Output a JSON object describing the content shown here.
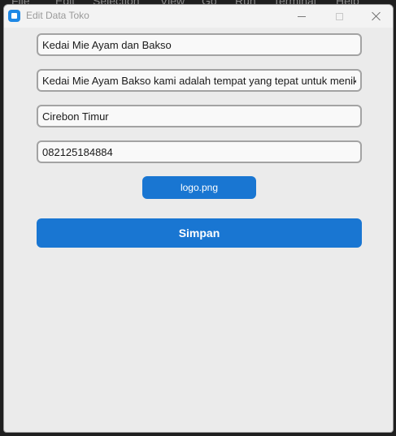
{
  "background_menu": {
    "items": [
      "File",
      "Edit",
      "Selection",
      "View",
      "Go",
      "Run",
      "Terminal",
      "Help"
    ]
  },
  "window": {
    "title": "Edit Data Toko",
    "icon": "app-window-icon"
  },
  "form": {
    "store_name": "Kedai Mie Ayam dan Bakso",
    "description": "Kedai Mie Ayam Bakso kami adalah tempat yang tepat untuk menikmati",
    "address": "Cirebon Timur",
    "phone": "082125184884",
    "logo_button_label": "logo.png",
    "save_button_label": "Simpan"
  },
  "colors": {
    "accent": "#1976d2",
    "window_bg": "#ebebeb"
  }
}
